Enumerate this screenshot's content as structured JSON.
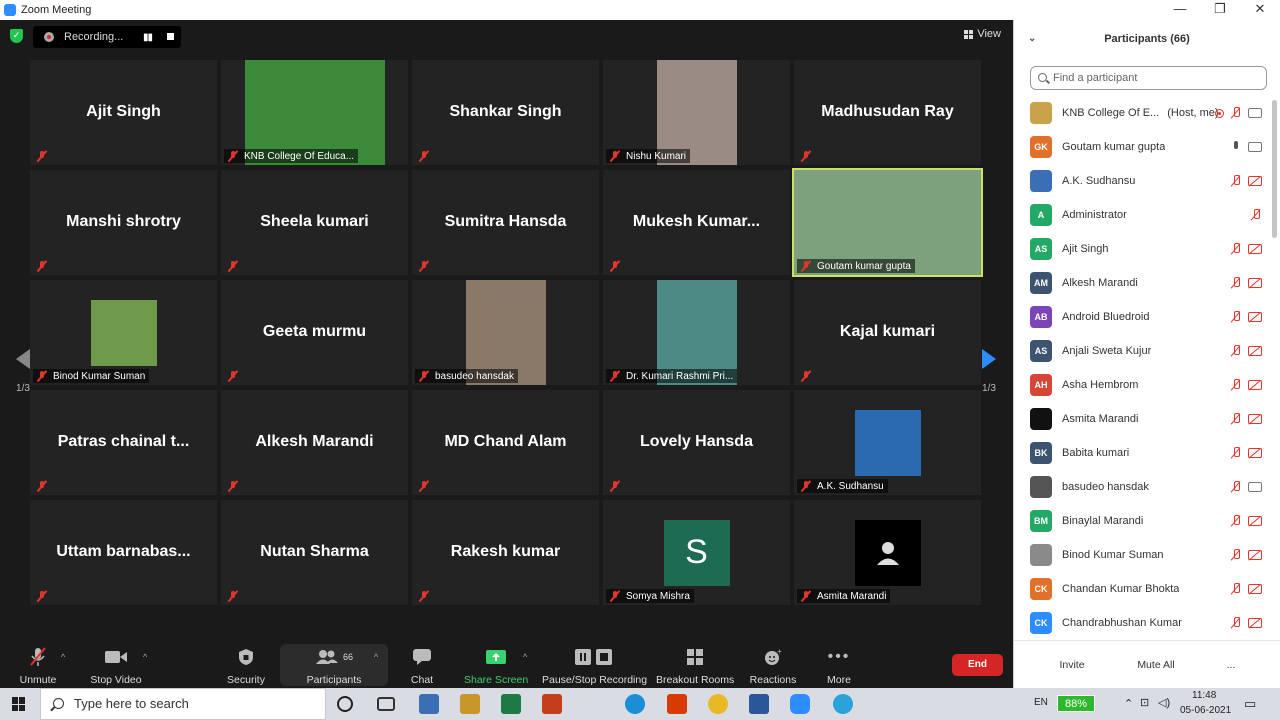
{
  "window": {
    "title": "Zoom Meeting",
    "controls": [
      "—",
      "❐",
      "✕"
    ]
  },
  "topbar": {
    "recording_label": "Recording...",
    "view_label": "View"
  },
  "grid": {
    "tiles": [
      {
        "type": "name",
        "name": "Ajit Singh"
      },
      {
        "type": "video",
        "label": "KNB College Of Educa...",
        "bg": "#3a8a3a"
      },
      {
        "type": "name",
        "name": "Shankar Singh"
      },
      {
        "type": "video",
        "label": "Nishu Kumari",
        "bg": "#9a8c85"
      },
      {
        "type": "name",
        "name": "Madhusudan Ray"
      },
      {
        "type": "name",
        "name": "Manshi shrotry"
      },
      {
        "type": "name",
        "name": "Sheela kumari"
      },
      {
        "type": "name",
        "name": "Sumitra Hansda"
      },
      {
        "type": "name",
        "name": "Mukesh  Kumar..."
      },
      {
        "type": "video-wide",
        "label": "Goutam kumar gupta",
        "bg": "#7da07d",
        "active": true
      },
      {
        "type": "photo",
        "label": "Binod Kumar Suman",
        "bg": "#6f9a4a"
      },
      {
        "type": "name",
        "name": "Geeta murmu"
      },
      {
        "type": "video",
        "label": "basudeo hansdak",
        "bg": "#8a7868"
      },
      {
        "type": "video",
        "label": "Dr. Kumari Rashmi Pri...",
        "bg": "#4d8a86"
      },
      {
        "type": "name",
        "name": "Kajal kumari"
      },
      {
        "type": "name",
        "name": "Patras chainal  t..."
      },
      {
        "type": "name",
        "name": "Alkesh Marandi"
      },
      {
        "type": "name",
        "name": "MD Chand Alam"
      },
      {
        "type": "name",
        "name": "Lovely Hansda"
      },
      {
        "type": "photo",
        "label": "A.K. Sudhansu",
        "bg": "#2a6ab0"
      },
      {
        "type": "name",
        "name": "Uttam  barnabas..."
      },
      {
        "type": "name",
        "name": "Nutan Sharma"
      },
      {
        "type": "name",
        "name": "Rakesh kumar"
      },
      {
        "type": "letter",
        "label": "Somya Mishra",
        "letter": "S",
        "bg": "#1d6b53"
      },
      {
        "type": "avatar",
        "label": "Asmita Marandi",
        "bg": "#000000"
      }
    ]
  },
  "pagination": {
    "left": "1/3",
    "right": "1/3"
  },
  "toolbar": {
    "unmute": "Unmute",
    "stop_video": "Stop Video",
    "security": "Security",
    "participants": "Participants",
    "participants_count": "66",
    "chat": "Chat",
    "share_screen": "Share Screen",
    "recording": "Pause/Stop Recording",
    "breakout": "Breakout Rooms",
    "reactions": "Reactions",
    "more": "More",
    "end": "End"
  },
  "panel": {
    "title": "Participants (66)",
    "search_placeholder": "Find a participant",
    "participants": [
      {
        "name": "KNB College Of E...",
        "note": "(Host, me)",
        "avatar": "img",
        "color": "#c9a24b",
        "mic": "off",
        "cam": "on",
        "rec": true
      },
      {
        "name": "Goutam kumar gupta",
        "initials": "GK",
        "color": "#e0702a",
        "mic": "on",
        "cam": "on"
      },
      {
        "name": "A.K. Sudhansu",
        "avatar": "img",
        "color": "#3a6fb5",
        "mic": "off",
        "cam": "off"
      },
      {
        "name": "Administrator",
        "initials": "A",
        "color": "#23a965",
        "mic": "off",
        "cam": "none"
      },
      {
        "name": "Ajit Singh",
        "initials": "AS",
        "color": "#23a965",
        "mic": "off",
        "cam": "off"
      },
      {
        "name": "Alkesh Marandi",
        "initials": "AM",
        "color": "#3d5470",
        "mic": "off",
        "cam": "off"
      },
      {
        "name": "Android Bluedroid",
        "initials": "AB",
        "color": "#7b45b8",
        "mic": "off",
        "cam": "off"
      },
      {
        "name": "Anjali Sweta Kujur",
        "initials": "AS",
        "color": "#3d5470",
        "mic": "off",
        "cam": "off"
      },
      {
        "name": "Asha Hembrom",
        "initials": "AH",
        "color": "#d64536",
        "mic": "off",
        "cam": "off"
      },
      {
        "name": "Asmita Marandi",
        "avatar": "img",
        "color": "#111111",
        "mic": "off",
        "cam": "off"
      },
      {
        "name": "Babita kumari",
        "initials": "BK",
        "color": "#3d5470",
        "mic": "off",
        "cam": "off"
      },
      {
        "name": "basudeo hansdak",
        "avatar": "img",
        "color": "#555555",
        "mic": "off",
        "cam": "on"
      },
      {
        "name": "Binaylal Marandi",
        "initials": "BM",
        "color": "#23a965",
        "mic": "off",
        "cam": "off"
      },
      {
        "name": "Binod Kumar Suman",
        "avatar": "img",
        "color": "#8a8a8a",
        "mic": "off",
        "cam": "off"
      },
      {
        "name": "Chandan Kumar Bhokta",
        "initials": "CK",
        "color": "#e0702a",
        "mic": "off",
        "cam": "off"
      },
      {
        "name": "Chandrabhushan Kumar",
        "initials": "CK",
        "color": "#2d8cff",
        "mic": "off",
        "cam": "off"
      }
    ],
    "invite": "Invite",
    "mute_all": "Mute All",
    "more": "..."
  },
  "taskbar": {
    "search_placeholder": "Type here to search",
    "lang": "EN",
    "battery": "88%",
    "time": "11:48",
    "date": "05-06-2021"
  }
}
